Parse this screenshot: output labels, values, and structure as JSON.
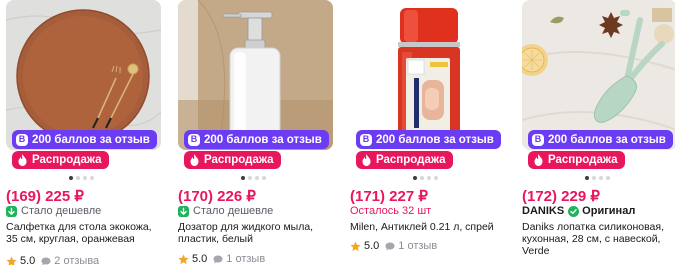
{
  "products": [
    {
      "bonus_icon": "В",
      "bonus_label": "200 баллов за отзыв",
      "sale_label": "Распродажа",
      "price": "(169) 225 ₽",
      "status": "Стало дешевле",
      "title": "Салфетка для стола экокожа, 35 см, круглая, оранжевая",
      "rating": "5.0",
      "reviews": "2 отзыва"
    },
    {
      "bonus_icon": "В",
      "bonus_label": "200 баллов за отзыв",
      "sale_label": "Распродажа",
      "price": "(170) 226 ₽",
      "status": "Стало дешевле",
      "title": "Дозатор для жидкого мыла, пластик, белый",
      "rating": "5.0",
      "reviews": "1 отзыв"
    },
    {
      "bonus_icon": "В",
      "bonus_label": "200 баллов за отзыв",
      "sale_label": "Распродажа",
      "price": "(171) 227 ₽",
      "status": "Осталось 32 шт",
      "title": "Milen, Антиклей 0.21 л, спрей",
      "rating": "5.0",
      "reviews": "1 отзыв"
    },
    {
      "bonus_icon": "В",
      "bonus_label": "200 баллов за отзыв",
      "sale_label": "Распродажа",
      "price": "(172) 229 ₽",
      "brand": "DANIKS",
      "original_label": "Оригинал",
      "title": "Daniks лопатка силиконовая, кухонная, 28 см, с навеской, Verde"
    }
  ],
  "colors": {
    "price": "#e8175d",
    "bonus_badge": "#6c3cf5",
    "sale_badge": "#e8175d",
    "price_down": "#21b35a",
    "rating_star": "#f5a623"
  },
  "icons": {
    "bonus": "bonus-points-icon",
    "sale": "flame-icon",
    "status": "price-down-icon",
    "original": "verified-check-icon",
    "rating": "star-icon",
    "reviews": "comment-icon"
  },
  "carousel": {
    "dots_count": 4,
    "active_dot": 1
  }
}
